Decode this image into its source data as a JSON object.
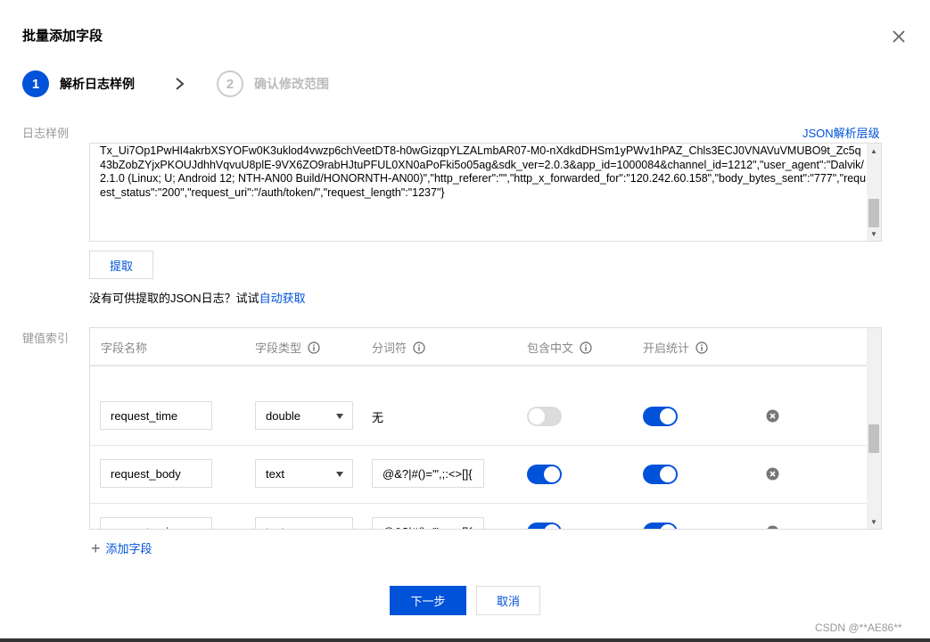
{
  "dialog": {
    "title": "批量添加字段"
  },
  "steps": [
    {
      "number": "1",
      "label": "解析日志样例"
    },
    {
      "number": "2",
      "label": "确认修改范围"
    }
  ],
  "log_sample": {
    "label": "日志样例",
    "json_level_link": "JSON解析层级",
    "text": "Tx_Ui7Op1PwHI4akrbXSYOFw0K3uklod4vwzp6chVeetDT8-h0wGizqpYLZALmbAR07-M0-nXdkdDHSm1yPWv1hPAZ_Chls3ECJ0VNAVuVMUBO9t_Zc5q43bZobZYjxPKOUJdhhVqvuU8plE-9VX6ZO9rabHJtuPFUL0XN0aPoFki5o05ag&sdk_ver=2.0.3&app_id=1000084&channel_id=1212\",\"user_agent\":\"Dalvik/2.1.0 (Linux; U; Android 12; NTH-AN00 Build/HONORNTH-AN00)\",\"http_referer\":\"\",\"http_x_forwarded_for\":\"120.242.60.158\",\"body_bytes_sent\":\"777\",\"request_status\":\"200\",\"request_uri\":\"/auth/token/\",\"request_length\":\"1237\"}"
  },
  "extract_button": "提取",
  "hint": {
    "text": "没有可供提取的JSON日志？试试",
    "link": "自动获取"
  },
  "kv_index": {
    "label": "键值索引",
    "headers": {
      "name": "字段名称",
      "type": "字段类型",
      "separator": "分词符",
      "chinese": "包含中文",
      "stats": "开启统计"
    },
    "rows": [
      {
        "name": "request_time",
        "type": "double",
        "separator_text": "无",
        "chinese": false,
        "stats": true
      },
      {
        "name": "request_body",
        "type": "text",
        "separator_value": "@&?|#()='\",;:<>[]{",
        "chinese": true,
        "stats": true
      },
      {
        "name": "request_uri",
        "type": "text",
        "separator_value": "@&?|#()='\",;:<>[]{",
        "chinese": true,
        "stats": true
      }
    ]
  },
  "add_field": "添加字段",
  "footer": {
    "next": "下一步",
    "cancel": "取消"
  },
  "watermark": "CSDN @**AE86**",
  "colors": {
    "primary": "#0052d9",
    "border": "#dcdcdc",
    "muted": "#999999"
  }
}
